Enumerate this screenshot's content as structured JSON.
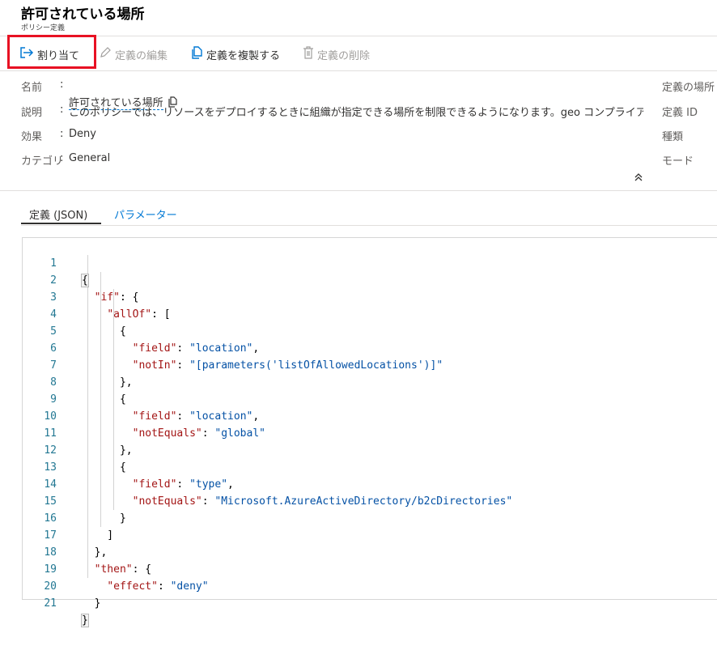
{
  "header": {
    "title": "許可されている場所",
    "subtitle": "ポリシー定義"
  },
  "toolbar": {
    "assign": "割り当て",
    "edit": "定義の編集",
    "duplicate": "定義を複製する",
    "delete": "定義の削除"
  },
  "properties": {
    "name_key": "名前",
    "name_value": "許可されている場所",
    "desc_key": "説明",
    "desc_value": "このポリシーでは、リソースをデプロイするときに組織が指定できる場所を制限できるようになります。geo コンプライアンス要...",
    "effect_key": "効果",
    "effect_value": "Deny",
    "category_key": "カテゴリ",
    "category_value": "General",
    "sep": ":"
  },
  "right_properties": {
    "location": "定義の場所",
    "id": "定義 ID",
    "type": "種類",
    "mode": "モード"
  },
  "tabs": {
    "definition": "定義 (JSON)",
    "parameters": "パラメーター"
  },
  "code": {
    "line_numbers": [
      "1",
      "2",
      "3",
      "4",
      "5",
      "6",
      "7",
      "8",
      "9",
      "10",
      "11",
      "12",
      "13",
      "14",
      "15",
      "16",
      "17",
      "18",
      "19",
      "20",
      "21"
    ],
    "k_if": "\"if\"",
    "k_allOf": "\"allOf\"",
    "k_field": "\"field\"",
    "k_notIn": "\"notIn\"",
    "k_notEquals": "\"notEquals\"",
    "k_then": "\"then\"",
    "k_effect": "\"effect\"",
    "v_location": "\"location\"",
    "v_params": "\"[parameters('listOfAllowedLocations')]\"",
    "v_global": "\"global\"",
    "v_type": "\"type\"",
    "v_b2c": "\"Microsoft.AzureActiveDirectory/b2cDirectories\"",
    "v_deny": "\"deny\""
  }
}
